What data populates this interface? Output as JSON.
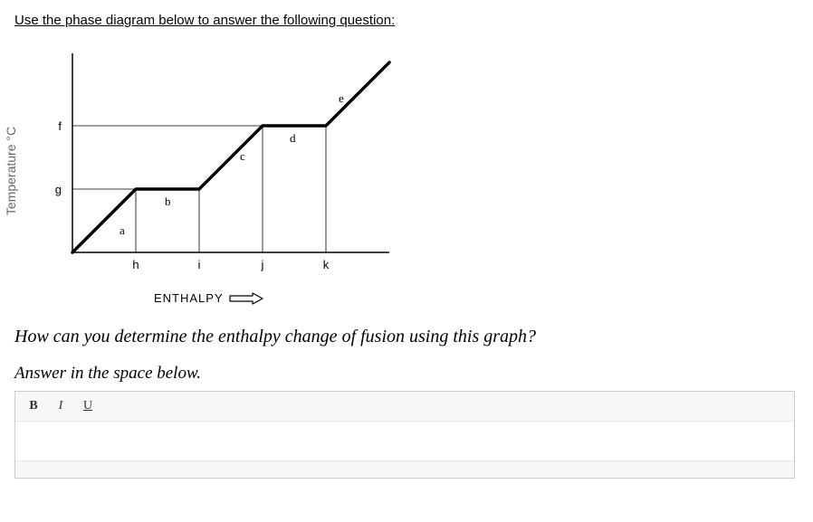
{
  "instruction": "Use the phase diagram below to answer the following question:",
  "chart_data": {
    "type": "line",
    "title": "",
    "xlabel": "ENTHALPY",
    "ylabel": "Temperature °C",
    "y_ticks": [
      "g",
      "f"
    ],
    "x_ticks": [
      "h",
      "i",
      "j",
      "k"
    ],
    "segment_labels": [
      "a",
      "b",
      "c",
      "d",
      "e"
    ],
    "x": [
      0,
      1,
      2,
      3,
      4,
      5
    ],
    "y": [
      0,
      1,
      1,
      2,
      2,
      3
    ],
    "xlim": [
      0,
      5
    ],
    "ylim": [
      0,
      3
    ]
  },
  "question": "How can you determine the enthalpy change of fusion using this graph?",
  "answer_label": "Answer in the space below.",
  "toolbar": {
    "bold": "B",
    "italic": "I",
    "underline": "U"
  },
  "editor_value": ""
}
